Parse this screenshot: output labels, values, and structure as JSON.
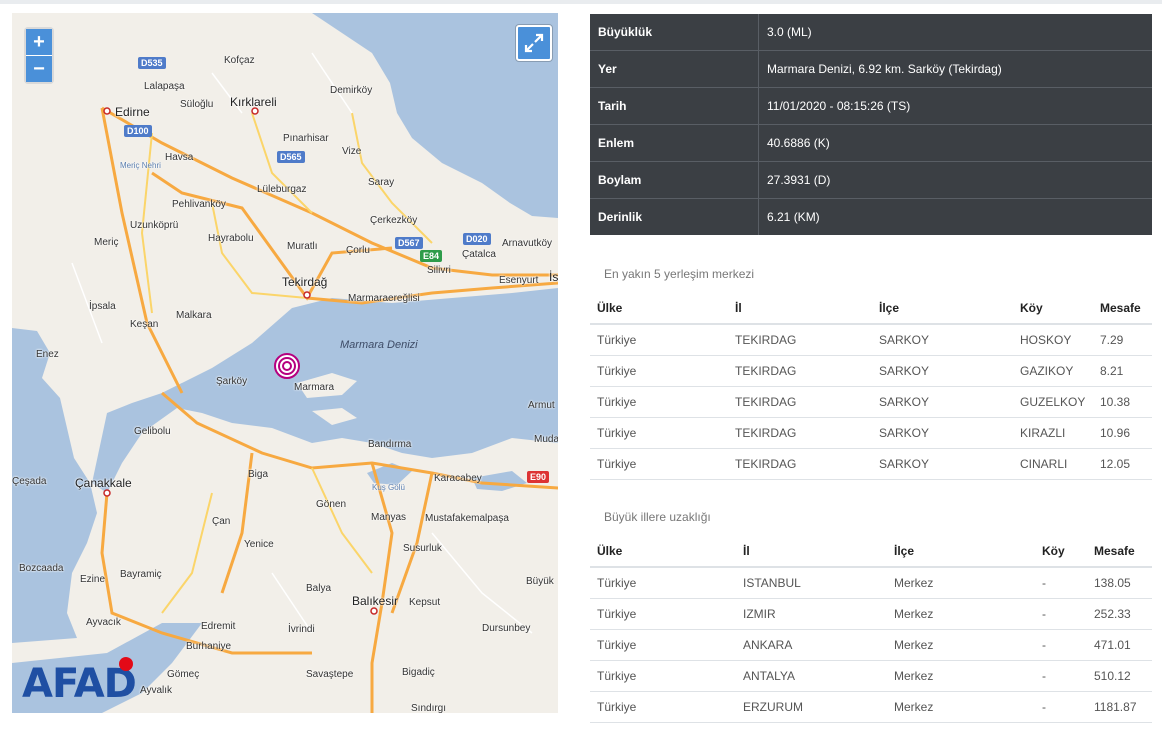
{
  "map": {
    "zoom_in": "+",
    "zoom_out": "−",
    "sea_label": "Marmara Denizi",
    "logo_text": "AFAD",
    "labels": [
      {
        "text": "Kofçaz"
      },
      {
        "text": "Lalapaşa"
      },
      {
        "text": "Süloğlu"
      },
      {
        "text": "Kırklareli"
      },
      {
        "text": "Demirköy"
      },
      {
        "text": "Edirne"
      },
      {
        "text": "Pınarhisar"
      },
      {
        "text": "Havsa"
      },
      {
        "text": "Vize"
      },
      {
        "text": "Meriç Nehri"
      },
      {
        "text": "Lüleburgaz"
      },
      {
        "text": "Saray"
      },
      {
        "text": "Pehlivanköy"
      },
      {
        "text": "Çerkezköy"
      },
      {
        "text": "Uzunköprü"
      },
      {
        "text": "Hayrabolu"
      },
      {
        "text": "Arnavutköy"
      },
      {
        "text": "Meriç"
      },
      {
        "text": "Muratlı"
      },
      {
        "text": "Çorlu"
      },
      {
        "text": "Çatalca"
      },
      {
        "text": "Silivri"
      },
      {
        "text": "Esenyurt"
      },
      {
        "text": "Tekirdağ"
      },
      {
        "text": "İs"
      },
      {
        "text": "İpsala"
      },
      {
        "text": "Marmaraereğlisi"
      },
      {
        "text": "Malkara"
      },
      {
        "text": "Keşan"
      },
      {
        "text": "Enez"
      },
      {
        "text": "Şarköy"
      },
      {
        "text": "Marmara"
      },
      {
        "text": "Armut"
      },
      {
        "text": "Gelibolu"
      },
      {
        "text": "Muda"
      },
      {
        "text": "Bandırma"
      },
      {
        "text": "Biga"
      },
      {
        "text": "Karacabey"
      },
      {
        "text": "Çeşada"
      },
      {
        "text": "Çanakkale"
      },
      {
        "text": "Kuş Gölü"
      },
      {
        "text": "Gönen"
      },
      {
        "text": "Çan"
      },
      {
        "text": "Manyas"
      },
      {
        "text": "Mustafakemalpaşa"
      },
      {
        "text": "Yenice"
      },
      {
        "text": "Susurluk"
      },
      {
        "text": "Bozcaada"
      },
      {
        "text": "Bayramiç"
      },
      {
        "text": "Ezine"
      },
      {
        "text": "Büyük"
      },
      {
        "text": "Balya"
      },
      {
        "text": "Balıkesir"
      },
      {
        "text": "Kepsut"
      },
      {
        "text": "Ayvacık"
      },
      {
        "text": "Edremit"
      },
      {
        "text": "İvrindi"
      },
      {
        "text": "Dursunbey"
      },
      {
        "text": "Burhaniye"
      },
      {
        "text": "Gömeç"
      },
      {
        "text": "Savaştepe"
      },
      {
        "text": "Bigadiç"
      },
      {
        "text": "Ayvalık"
      },
      {
        "text": "Sındırgı"
      }
    ],
    "road_shields": [
      "D535",
      "D100",
      "D565",
      "D567",
      "D020",
      "E84",
      "E90"
    ],
    "colors": {
      "sea": "#aac3df",
      "land": "#f2efe9",
      "motorway": "#f7a941",
      "road": "#fbd56a",
      "epicenter": "#b5007f"
    }
  },
  "details": [
    {
      "key": "Büyüklük",
      "value": "3.0 (ML)"
    },
    {
      "key": "Yer",
      "value": "Marmara Denizi, 6.92 km. Sarköy (Tekirdag)"
    },
    {
      "key": "Tarih",
      "value": "11/01/2020 - 08:15:26 (TS)"
    },
    {
      "key": "Enlem",
      "value": "40.6886 (K)"
    },
    {
      "key": "Boylam",
      "value": "27.3931 (D)"
    },
    {
      "key": "Derinlik",
      "value": "6.21 (KM)"
    }
  ],
  "nearest": {
    "title": "En yakın 5 yerleşim merkezi",
    "headers": [
      "Ülke",
      "İl",
      "İlçe",
      "Köy",
      "Mesafe"
    ],
    "rows": [
      [
        "Türkiye",
        "TEKIRDAG",
        "SARKOY",
        "HOSKOY",
        "7.29"
      ],
      [
        "Türkiye",
        "TEKIRDAG",
        "SARKOY",
        "GAZIKOY",
        "8.21"
      ],
      [
        "Türkiye",
        "TEKIRDAG",
        "SARKOY",
        "GUZELKOY",
        "10.38"
      ],
      [
        "Türkiye",
        "TEKIRDAG",
        "SARKOY",
        "KIRAZLI",
        "10.96"
      ],
      [
        "Türkiye",
        "TEKIRDAG",
        "SARKOY",
        "CINARLI",
        "12.05"
      ]
    ]
  },
  "cities": {
    "title": "Büyük illere uzaklığı",
    "headers": [
      "Ülke",
      "İl",
      "İlçe",
      "Köy",
      "Mesafe"
    ],
    "rows": [
      [
        "Türkiye",
        "ISTANBUL",
        "Merkez",
        "-",
        "138.05"
      ],
      [
        "Türkiye",
        "IZMIR",
        "Merkez",
        "-",
        "252.33"
      ],
      [
        "Türkiye",
        "ANKARA",
        "Merkez",
        "-",
        "471.01"
      ],
      [
        "Türkiye",
        "ANTALYA",
        "Merkez",
        "-",
        "510.12"
      ],
      [
        "Türkiye",
        "ERZURUM",
        "Merkez",
        "-",
        "1181.87"
      ]
    ]
  }
}
